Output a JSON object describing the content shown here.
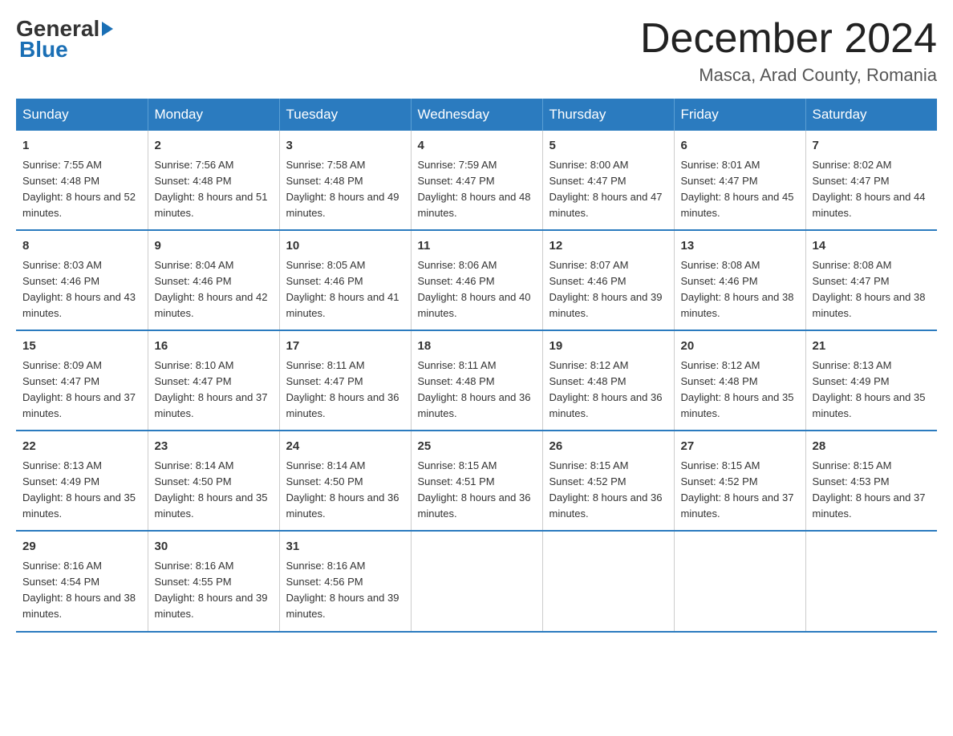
{
  "logo": {
    "general_text": "General",
    "blue_text": "Blue"
  },
  "title": "December 2024",
  "location": "Masca, Arad County, Romania",
  "days_of_week": [
    "Sunday",
    "Monday",
    "Tuesday",
    "Wednesday",
    "Thursday",
    "Friday",
    "Saturday"
  ],
  "weeks": [
    [
      {
        "day": "1",
        "sunrise": "7:55 AM",
        "sunset": "4:48 PM",
        "daylight": "8 hours and 52 minutes."
      },
      {
        "day": "2",
        "sunrise": "7:56 AM",
        "sunset": "4:48 PM",
        "daylight": "8 hours and 51 minutes."
      },
      {
        "day": "3",
        "sunrise": "7:58 AM",
        "sunset": "4:48 PM",
        "daylight": "8 hours and 49 minutes."
      },
      {
        "day": "4",
        "sunrise": "7:59 AM",
        "sunset": "4:47 PM",
        "daylight": "8 hours and 48 minutes."
      },
      {
        "day": "5",
        "sunrise": "8:00 AM",
        "sunset": "4:47 PM",
        "daylight": "8 hours and 47 minutes."
      },
      {
        "day": "6",
        "sunrise": "8:01 AM",
        "sunset": "4:47 PM",
        "daylight": "8 hours and 45 minutes."
      },
      {
        "day": "7",
        "sunrise": "8:02 AM",
        "sunset": "4:47 PM",
        "daylight": "8 hours and 44 minutes."
      }
    ],
    [
      {
        "day": "8",
        "sunrise": "8:03 AM",
        "sunset": "4:46 PM",
        "daylight": "8 hours and 43 minutes."
      },
      {
        "day": "9",
        "sunrise": "8:04 AM",
        "sunset": "4:46 PM",
        "daylight": "8 hours and 42 minutes."
      },
      {
        "day": "10",
        "sunrise": "8:05 AM",
        "sunset": "4:46 PM",
        "daylight": "8 hours and 41 minutes."
      },
      {
        "day": "11",
        "sunrise": "8:06 AM",
        "sunset": "4:46 PM",
        "daylight": "8 hours and 40 minutes."
      },
      {
        "day": "12",
        "sunrise": "8:07 AM",
        "sunset": "4:46 PM",
        "daylight": "8 hours and 39 minutes."
      },
      {
        "day": "13",
        "sunrise": "8:08 AM",
        "sunset": "4:46 PM",
        "daylight": "8 hours and 38 minutes."
      },
      {
        "day": "14",
        "sunrise": "8:08 AM",
        "sunset": "4:47 PM",
        "daylight": "8 hours and 38 minutes."
      }
    ],
    [
      {
        "day": "15",
        "sunrise": "8:09 AM",
        "sunset": "4:47 PM",
        "daylight": "8 hours and 37 minutes."
      },
      {
        "day": "16",
        "sunrise": "8:10 AM",
        "sunset": "4:47 PM",
        "daylight": "8 hours and 37 minutes."
      },
      {
        "day": "17",
        "sunrise": "8:11 AM",
        "sunset": "4:47 PM",
        "daylight": "8 hours and 36 minutes."
      },
      {
        "day": "18",
        "sunrise": "8:11 AM",
        "sunset": "4:48 PM",
        "daylight": "8 hours and 36 minutes."
      },
      {
        "day": "19",
        "sunrise": "8:12 AM",
        "sunset": "4:48 PM",
        "daylight": "8 hours and 36 minutes."
      },
      {
        "day": "20",
        "sunrise": "8:12 AM",
        "sunset": "4:48 PM",
        "daylight": "8 hours and 35 minutes."
      },
      {
        "day": "21",
        "sunrise": "8:13 AM",
        "sunset": "4:49 PM",
        "daylight": "8 hours and 35 minutes."
      }
    ],
    [
      {
        "day": "22",
        "sunrise": "8:13 AM",
        "sunset": "4:49 PM",
        "daylight": "8 hours and 35 minutes."
      },
      {
        "day": "23",
        "sunrise": "8:14 AM",
        "sunset": "4:50 PM",
        "daylight": "8 hours and 35 minutes."
      },
      {
        "day": "24",
        "sunrise": "8:14 AM",
        "sunset": "4:50 PM",
        "daylight": "8 hours and 36 minutes."
      },
      {
        "day": "25",
        "sunrise": "8:15 AM",
        "sunset": "4:51 PM",
        "daylight": "8 hours and 36 minutes."
      },
      {
        "day": "26",
        "sunrise": "8:15 AM",
        "sunset": "4:52 PM",
        "daylight": "8 hours and 36 minutes."
      },
      {
        "day": "27",
        "sunrise": "8:15 AM",
        "sunset": "4:52 PM",
        "daylight": "8 hours and 37 minutes."
      },
      {
        "day": "28",
        "sunrise": "8:15 AM",
        "sunset": "4:53 PM",
        "daylight": "8 hours and 37 minutes."
      }
    ],
    [
      {
        "day": "29",
        "sunrise": "8:16 AM",
        "sunset": "4:54 PM",
        "daylight": "8 hours and 38 minutes."
      },
      {
        "day": "30",
        "sunrise": "8:16 AM",
        "sunset": "4:55 PM",
        "daylight": "8 hours and 39 minutes."
      },
      {
        "day": "31",
        "sunrise": "8:16 AM",
        "sunset": "4:56 PM",
        "daylight": "8 hours and 39 minutes."
      },
      null,
      null,
      null,
      null
    ]
  ]
}
